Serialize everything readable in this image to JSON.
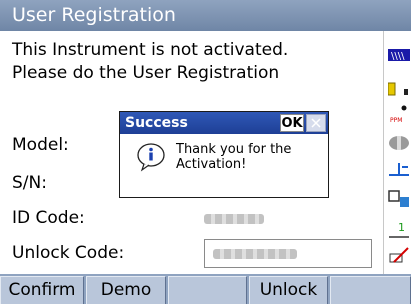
{
  "window": {
    "title": "User Registration"
  },
  "message": {
    "line1": "This Instrument is not activated.",
    "line2": "Please do the User Registration"
  },
  "fields": {
    "model_label": "Model:",
    "sn_label": "S/N:",
    "id_code_label": "ID Code:",
    "unlock_code_label": "Unlock Code:"
  },
  "dialog": {
    "title": "Success",
    "ok_label": "OK",
    "message_line1": "Thank you for the",
    "message_line2": "Activation!"
  },
  "softkeys": [
    "Confirm",
    "Demo",
    "",
    "Unlock",
    ""
  ],
  "status_icons": [
    "battery-level-icon",
    "battery-icon",
    "laser-icon",
    "prism-icon",
    "target-height-icon",
    "communication-icon",
    "tilt-icon",
    "edit-icon"
  ],
  "colors": {
    "titlebar": "#7f95b4",
    "dialog_title": "#2a4fa8",
    "softkey_bg": "#b9c6da"
  }
}
